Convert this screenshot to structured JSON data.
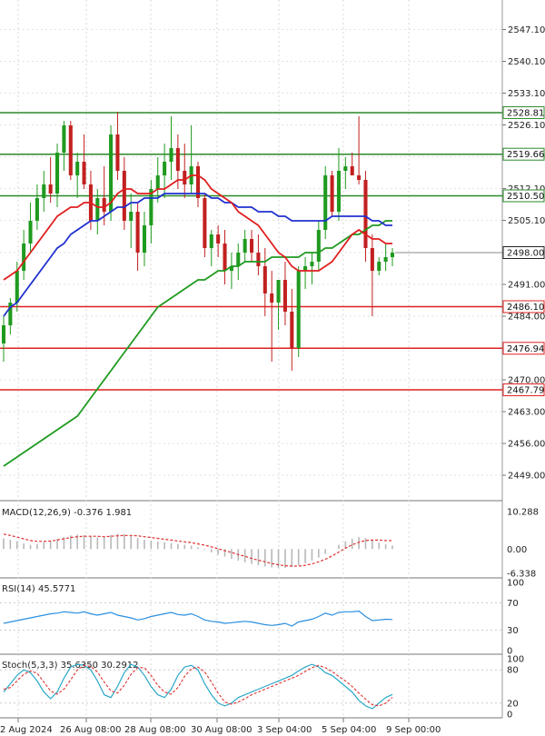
{
  "chart_data": {
    "type": "candlestick",
    "price_axis": {
      "ticks": [
        "2547.10",
        "2540.10",
        "2533.10",
        "2526.10",
        "2519.10",
        "2512.10",
        "2505.10",
        "2498.00",
        "2491.00",
        "2484.00",
        "2470.00",
        "2463.00",
        "2456.00",
        "2449.00"
      ],
      "current": "2498.00",
      "range": [
        2444,
        2552
      ]
    },
    "x_ticks": [
      "2 Aug 2024",
      "26 Aug 08:00",
      "28 Aug 08:00",
      "30 Aug 08:00",
      "3 Sep 04:00",
      "5 Sep 04:00",
      "9 Sep 00:00"
    ],
    "levels": [
      {
        "value": "2528.81",
        "color": "#2a8a2a"
      },
      {
        "value": "2519.66",
        "color": "#2a8a2a"
      },
      {
        "value": "2510.50",
        "color": "#2a8a2a"
      },
      {
        "value": "2486.10",
        "color": "#e02020"
      },
      {
        "value": "2476.94",
        "color": "#e02020"
      },
      {
        "value": "2467.79",
        "color": "#e02020"
      }
    ],
    "candles": [
      [
        2478,
        2484,
        2474,
        2482
      ],
      [
        2482,
        2488,
        2480,
        2487
      ],
      [
        2487,
        2496,
        2485,
        2494
      ],
      [
        2494,
        2503,
        2492,
        2500
      ],
      [
        2500,
        2509,
        2498,
        2505
      ],
      [
        2505,
        2513,
        2503,
        2510
      ],
      [
        2510,
        2516,
        2507,
        2513
      ],
      [
        2513,
        2519,
        2509,
        2511
      ],
      [
        2511,
        2522,
        2508,
        2520
      ],
      [
        2520,
        2527,
        2516,
        2526
      ],
      [
        2526,
        2527,
        2514,
        2515
      ],
      [
        2515,
        2520,
        2510,
        2518
      ],
      [
        2518,
        2524,
        2512,
        2513
      ],
      [
        2513,
        2516,
        2503,
        2505
      ],
      [
        2505,
        2512,
        2502,
        2510
      ],
      [
        2510,
        2517,
        2504,
        2507
      ],
      [
        2507,
        2526,
        2505,
        2524
      ],
      [
        2524,
        2529,
        2514,
        2516
      ],
      [
        2516,
        2519,
        2503,
        2505
      ],
      [
        2505,
        2511,
        2499,
        2507
      ],
      [
        2507,
        2509,
        2494,
        2498
      ],
      [
        2498,
        2507,
        2495,
        2504
      ],
      [
        2504,
        2514,
        2500,
        2512
      ],
      [
        2512,
        2519,
        2509,
        2515
      ],
      [
        2515,
        2522,
        2510,
        2518
      ],
      [
        2518,
        2528,
        2514,
        2521
      ],
      [
        2521,
        2524,
        2512,
        2516
      ],
      [
        2516,
        2522,
        2510,
        2513
      ],
      [
        2513,
        2526,
        2511,
        2517
      ],
      [
        2517,
        2518,
        2508,
        2510
      ],
      [
        2510,
        2511,
        2497,
        2499
      ],
      [
        2499,
        2503,
        2495,
        2502
      ],
      [
        2502,
        2504,
        2497,
        2500
      ],
      [
        2500,
        2503,
        2491,
        2494
      ],
      [
        2494,
        2498,
        2490,
        2495
      ],
      [
        2495,
        2500,
        2492,
        2498
      ],
      [
        2498,
        2503,
        2496,
        2501
      ],
      [
        2501,
        2503,
        2496,
        2498
      ],
      [
        2498,
        2502,
        2493,
        2495
      ],
      [
        2495,
        2499,
        2484,
        2489
      ],
      [
        2489,
        2494,
        2474,
        2487
      ],
      [
        2487,
        2492,
        2481,
        2492
      ],
      [
        2492,
        2496,
        2482,
        2485
      ],
      [
        2485,
        2490,
        2472,
        2477
      ],
      [
        2477,
        2495,
        2475,
        2494
      ],
      [
        2494,
        2497,
        2490,
        2495
      ],
      [
        2495,
        2498,
        2491,
        2496
      ],
      [
        2496,
        2505,
        2494,
        2503
      ],
      [
        2503,
        2517,
        2501,
        2515
      ],
      [
        2515,
        2516,
        2506,
        2507
      ],
      [
        2507,
        2521,
        2505,
        2516
      ],
      [
        2516,
        2519,
        2512,
        2517
      ],
      [
        2517,
        2520,
        2515,
        2515
      ],
      [
        2515,
        2528,
        2513,
        2514
      ],
      [
        2514,
        2516,
        2496,
        2499
      ],
      [
        2499,
        2502,
        2484,
        2494
      ],
      [
        2494,
        2497,
        2493,
        2496
      ],
      [
        2496,
        2500,
        2494,
        2497
      ],
      [
        2497,
        2499,
        2495,
        2498
      ]
    ],
    "ma_fast": [
      2492,
      2493,
      2494,
      2496,
      2498,
      2500,
      2502,
      2504,
      2506,
      2507,
      2508,
      2508,
      2509,
      2509,
      2508,
      2508,
      2509,
      2511,
      2512,
      2512,
      2511,
      2511,
      2511,
      2512,
      2512,
      2513,
      2514,
      2514,
      2515,
      2515,
      2514,
      2512,
      2511,
      2510,
      2509,
      2507,
      2506,
      2505,
      2504,
      2502,
      2500,
      2498,
      2497,
      2495,
      2494,
      2494,
      2494,
      2494,
      2495,
      2496,
      2498,
      2500,
      2502,
      2503,
      2502,
      2501,
      2501,
      2500,
      2500
    ],
    "ma_slow": [
      2484,
      2486,
      2487,
      2489,
      2491,
      2493,
      2495,
      2497,
      2499,
      2500,
      2502,
      2503,
      2504,
      2505,
      2505,
      2506,
      2507,
      2508,
      2508,
      2509,
      2509,
      2510,
      2510,
      2510,
      2511,
      2511,
      2511,
      2511,
      2511,
      2511,
      2511,
      2510,
      2510,
      2509,
      2509,
      2508,
      2508,
      2508,
      2507,
      2507,
      2507,
      2506,
      2506,
      2505,
      2505,
      2505,
      2505,
      2505,
      2505,
      2506,
      2506,
      2506,
      2506,
      2506,
      2506,
      2505,
      2505,
      2504,
      2504
    ],
    "ma_long": [
      2451,
      2452,
      2453,
      2454,
      2455,
      2456,
      2457,
      2458,
      2459,
      2460,
      2461,
      2462,
      2464,
      2466,
      2468,
      2470,
      2472,
      2474,
      2476,
      2478,
      2480,
      2482,
      2484,
      2486,
      2487,
      2488,
      2489,
      2490,
      2491,
      2492,
      2492,
      2493,
      2494,
      2494,
      2495,
      2495,
      2496,
      2496,
      2496,
      2496,
      2497,
      2497,
      2497,
      2497,
      2497,
      2498,
      2498,
      2498,
      2499,
      2499,
      2500,
      2501,
      2502,
      2502,
      2503,
      2504,
      2504,
      2505,
      2505
    ],
    "macd": {
      "label": "MACD(12,26,9) -0.376 1.981",
      "ticks": [
        "10.288",
        "0.00",
        "-6.338"
      ],
      "range": [
        -6.338,
        10.288
      ],
      "hist": [
        2.5,
        2.2,
        1.8,
        1.3,
        1.0,
        1.2,
        1.6,
        2.0,
        2.4,
        2.8,
        3.2,
        3.4,
        3.3,
        3.0,
        2.7,
        2.9,
        3.3,
        3.6,
        3.5,
        3.1,
        2.6,
        2.2,
        2.0,
        1.8,
        1.6,
        1.4,
        1.2,
        1.0,
        0.8,
        0.4,
        -0.2,
        -0.8,
        -1.3,
        -1.8,
        -2.3,
        -2.7,
        -3.1,
        -3.5,
        -3.8,
        -4.1,
        -4.3,
        -4.4,
        -4.4,
        -4.2,
        -3.8,
        -3.3,
        -2.7,
        -2.0,
        -1.1,
        0.0,
        1.0,
        1.8,
        2.4,
        2.8,
        2.6,
        2.1,
        1.5,
        1.1,
        0.8
      ],
      "signal": [
        3.5,
        3.2,
        2.8,
        2.4,
        2.0,
        1.8,
        1.8,
        1.9,
        2.1,
        2.4,
        2.7,
        2.9,
        3.0,
        3.0,
        3.0,
        2.9,
        3.0,
        3.1,
        3.2,
        3.2,
        3.1,
        2.9,
        2.7,
        2.5,
        2.3,
        2.1,
        1.9,
        1.7,
        1.5,
        1.2,
        0.9,
        0.5,
        0.1,
        -0.4,
        -0.8,
        -1.3,
        -1.7,
        -2.2,
        -2.6,
        -3.0,
        -3.4,
        -3.7,
        -3.9,
        -4.0,
        -4.0,
        -3.8,
        -3.5,
        -3.0,
        -2.4,
        -1.6,
        -0.7,
        0.2,
        1.0,
        1.6,
        2.0,
        2.1,
        2.1,
        2.0,
        1.98
      ]
    },
    "rsi": {
      "label": "RSI(14) 45.5771",
      "ticks": [
        "100",
        "70",
        "30",
        "0"
      ],
      "range": [
        0,
        100
      ],
      "values": [
        40,
        42,
        44,
        46,
        48,
        50,
        52,
        54,
        55,
        57,
        56,
        55,
        57,
        54,
        52,
        54,
        56,
        52,
        50,
        48,
        45,
        47,
        50,
        52,
        54,
        56,
        53,
        52,
        54,
        50,
        45,
        43,
        42,
        40,
        41,
        42,
        43,
        42,
        40,
        38,
        37,
        38,
        40,
        36,
        42,
        44,
        46,
        50,
        55,
        52,
        56,
        57,
        57,
        58,
        50,
        44,
        45,
        46,
        45.6
      ]
    },
    "stoch": {
      "label": "Stoch(5,3,3) 35.6350 30.2912",
      "ticks": [
        "100",
        "80",
        "20",
        "0"
      ],
      "range": [
        0,
        100
      ],
      "k": [
        40,
        55,
        70,
        80,
        75,
        60,
        40,
        28,
        40,
        65,
        85,
        90,
        88,
        80,
        60,
        35,
        30,
        50,
        75,
        90,
        85,
        70,
        50,
        35,
        30,
        45,
        70,
        85,
        88,
        80,
        55,
        35,
        20,
        15,
        20,
        30,
        35,
        40,
        45,
        50,
        55,
        60,
        65,
        70,
        78,
        85,
        90,
        85,
        75,
        70,
        60,
        50,
        40,
        25,
        15,
        10,
        20,
        30,
        35.6
      ],
      "d": [
        45,
        48,
        60,
        72,
        78,
        74,
        58,
        42,
        36,
        45,
        62,
        80,
        88,
        86,
        76,
        58,
        42,
        38,
        52,
        72,
        84,
        84,
        70,
        52,
        40,
        36,
        48,
        68,
        82,
        85,
        76,
        58,
        38,
        22,
        18,
        22,
        28,
        35,
        40,
        45,
        50,
        55,
        60,
        65,
        70,
        77,
        84,
        88,
        84,
        77,
        68,
        60,
        50,
        38,
        27,
        17,
        15,
        20,
        30.3
      ]
    }
  }
}
